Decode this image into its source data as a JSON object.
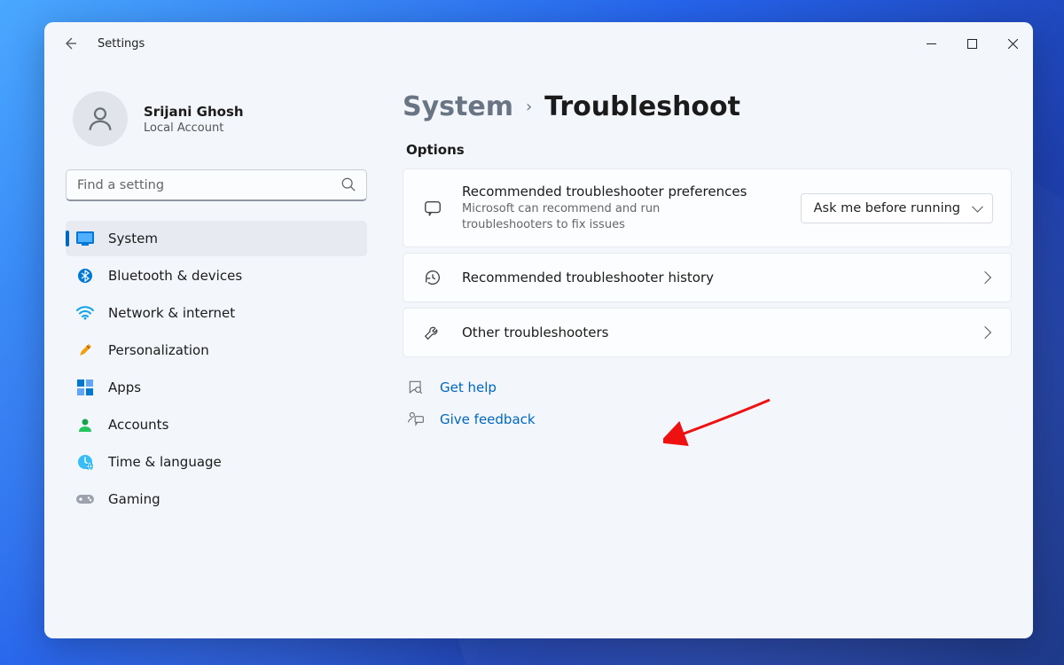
{
  "app": {
    "title": "Settings"
  },
  "account": {
    "name": "Srijani Ghosh",
    "type": "Local Account"
  },
  "search": {
    "placeholder": "Find a setting"
  },
  "nav": {
    "items": [
      {
        "label": "System"
      },
      {
        "label": "Bluetooth & devices"
      },
      {
        "label": "Network & internet"
      },
      {
        "label": "Personalization"
      },
      {
        "label": "Apps"
      },
      {
        "label": "Accounts"
      },
      {
        "label": "Time & language"
      },
      {
        "label": "Gaming"
      }
    ]
  },
  "breadcrumb": {
    "parent": "System",
    "current": "Troubleshoot"
  },
  "section": {
    "label": "Options"
  },
  "cards": {
    "pref": {
      "title": "Recommended troubleshooter preferences",
      "sub": "Microsoft can recommend and run troubleshooters to fix issues",
      "dropdown": "Ask me before running"
    },
    "history": {
      "title": "Recommended troubleshooter history"
    },
    "other": {
      "title": "Other troubleshooters"
    }
  },
  "links": {
    "help": "Get help",
    "feedback": "Give feedback"
  }
}
